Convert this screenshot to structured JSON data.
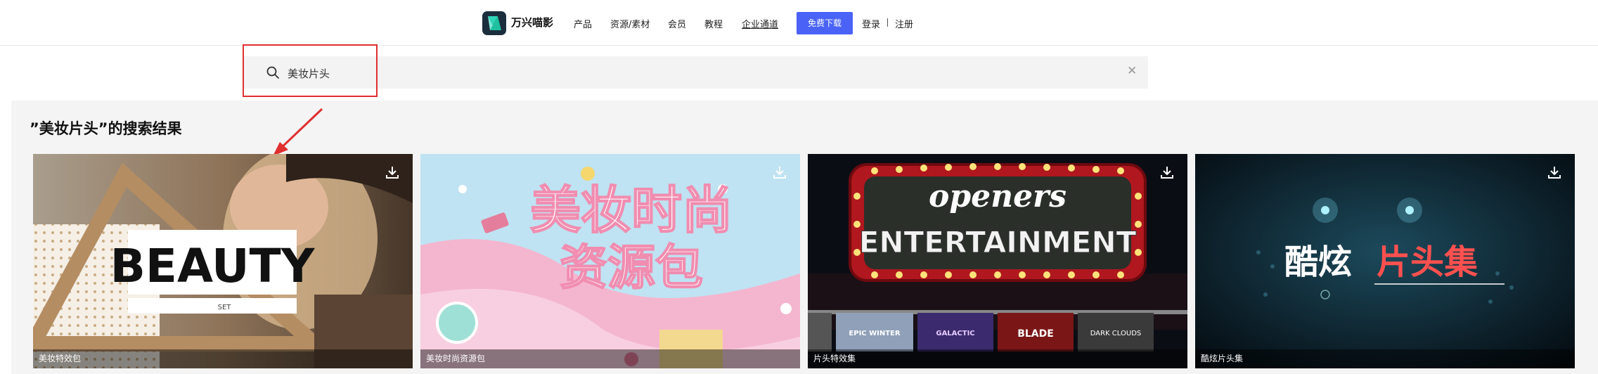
{
  "header": {
    "brand": "万兴喵影",
    "nav": [
      "产品",
      "资源/素材",
      "会员",
      "教程",
      "企业通道"
    ],
    "download_button": "免费下载",
    "login": "登录",
    "register": "注册"
  },
  "search": {
    "query": "美妆片头"
  },
  "results": {
    "title": "”美妆片头”的搜索结果",
    "cards": [
      {
        "label": "美妆特效包",
        "art_text": [
          "BEAUTY",
          "SET"
        ]
      },
      {
        "label": "美妆时尚资源包",
        "art_text": [
          "美妆时尚",
          "资源包"
        ]
      },
      {
        "label": "片头特效集",
        "art_text": [
          "openers",
          "ENTERTAINMENT",
          "EPIC WINTER",
          "GALACTIC",
          "BLADE",
          "DARK CLOUDS"
        ]
      },
      {
        "label": "酷炫片头集",
        "art_text": [
          "酷炫",
          "片头集"
        ]
      }
    ]
  },
  "colors": {
    "accent": "#4a63f6",
    "annotation": "#e03030"
  }
}
